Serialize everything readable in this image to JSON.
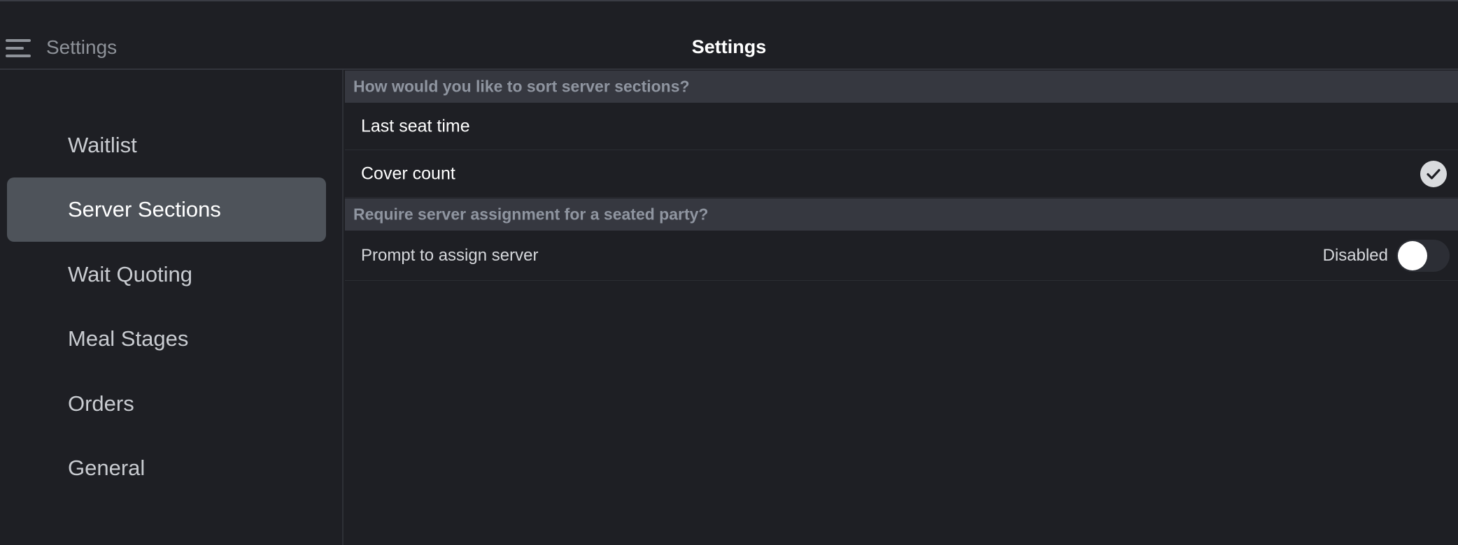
{
  "header": {
    "back_label": "Settings",
    "title": "Settings",
    "menu_icon": "hamburger-menu-icon"
  },
  "sidebar": {
    "items": [
      {
        "label": "Waitlist",
        "active": false
      },
      {
        "label": "Server Sections",
        "active": true
      },
      {
        "label": "Wait Quoting",
        "active": false
      },
      {
        "label": "Meal Stages",
        "active": false
      },
      {
        "label": "Orders",
        "active": false
      },
      {
        "label": "General",
        "active": false
      }
    ]
  },
  "main": {
    "sort_section": {
      "header": "How would you like to sort server sections?",
      "options": [
        {
          "label": "Last seat time",
          "selected": false
        },
        {
          "label": "Cover count",
          "selected": true
        }
      ]
    },
    "assign_section": {
      "header": "Require server assignment for a seated party?",
      "prompt_label": "Prompt to assign server",
      "status": "Disabled",
      "enabled": false
    }
  },
  "colors": {
    "background": "#1e1f24",
    "section_header": "#363840",
    "active_sidebar": "#4e535a",
    "checkmark_bg": "#d9dbde"
  }
}
